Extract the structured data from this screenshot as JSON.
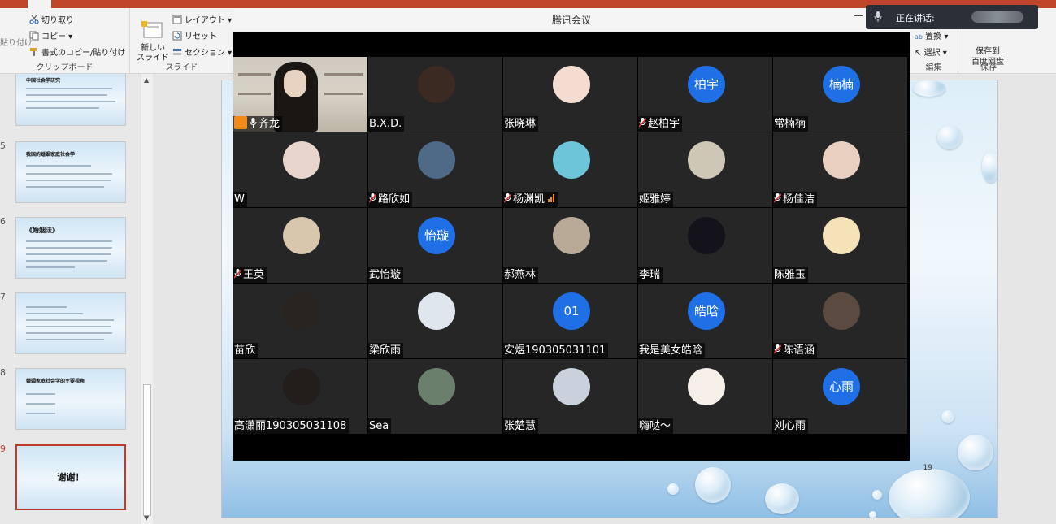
{
  "ribbon": {
    "paste_label": "貼り付け",
    "cut_label": "切り取り",
    "copy_label": "コピー",
    "format_painter_label": "書式のコピー/貼り付け",
    "clipboard_group": "クリップボード",
    "new_slide_label": "新しい\nスライド",
    "layout_label": "レイアウト",
    "reset_label": "リセット",
    "section_label": "セクション",
    "slides_group": "スライド",
    "replace_label": "置換",
    "select_label": "選択",
    "editing_group": "編集",
    "save_to_label": "保存到\n百度网盘",
    "save_group": "保存"
  },
  "slide_panel": {
    "thumbnails": [
      {
        "num": "",
        "title": "中国社会学研究"
      },
      {
        "num": "5",
        "title": "我国的婚姻家庭社会学"
      },
      {
        "num": "6",
        "title": "《婚姻法》"
      },
      {
        "num": "7",
        "title": ""
      },
      {
        "num": "8",
        "title": "婚姻家庭社会学的主要视角"
      },
      {
        "num": "9",
        "title": "谢谢！"
      }
    ]
  },
  "main_slide": {
    "page_number": "19"
  },
  "meeting": {
    "window_title": "腾讯会议",
    "speaking_label": "正在讲话:",
    "participants": [
      {
        "name": "齐龙",
        "muted": false,
        "host": true,
        "avatar_text": "",
        "avatar_color": ""
      },
      {
        "name": "B.X.D.",
        "muted": false,
        "avatar_text": "",
        "avatar_color": "#3a2a22"
      },
      {
        "name": "张晓琳",
        "muted": false,
        "avatar_text": "",
        "avatar_color": "#f3ddd0"
      },
      {
        "name": "赵柏宇",
        "muted": true,
        "avatar_text": "柏宇",
        "avatar_color": "#1f6fe6"
      },
      {
        "name": "常楠楠",
        "muted": false,
        "avatar_text": "楠楠",
        "avatar_color": "#1f6fe6"
      },
      {
        "name": "W",
        "muted": false,
        "avatar_text": "",
        "avatar_color": "#e8d6cc"
      },
      {
        "name": "路欣如",
        "muted": true,
        "avatar_text": "",
        "avatar_color": "#4e6a86"
      },
      {
        "name": "杨渊凯",
        "muted": true,
        "avatar_text": "",
        "avatar_color": "#6cc5d8",
        "signal": true
      },
      {
        "name": "姬雅婷",
        "muted": false,
        "avatar_text": "",
        "avatar_color": "#cfc7b6"
      },
      {
        "name": "杨佳洁",
        "muted": true,
        "avatar_text": "",
        "avatar_color": "#e9cfc0"
      },
      {
        "name": "王英",
        "muted": true,
        "avatar_text": "",
        "avatar_color": "#d8c6ad"
      },
      {
        "name": "武怡璇",
        "muted": false,
        "avatar_text": "怡璇",
        "avatar_color": "#1f6fe6"
      },
      {
        "name": "郝燕林",
        "muted": false,
        "avatar_text": "",
        "avatar_color": "#b9aa98"
      },
      {
        "name": "李瑞",
        "muted": false,
        "avatar_text": "",
        "avatar_color": "#14131c"
      },
      {
        "name": "陈雅玉",
        "muted": false,
        "avatar_text": "",
        "avatar_color": "#f5e2b8"
      },
      {
        "name": "苗欣",
        "muted": false,
        "avatar_text": "",
        "avatar_color": "#2a2420"
      },
      {
        "name": "梁欣雨",
        "muted": false,
        "avatar_text": "",
        "avatar_color": "#dfe6ee"
      },
      {
        "name": "安煜190305031101",
        "muted": false,
        "avatar_text": "01",
        "avatar_color": "#1f6fe6"
      },
      {
        "name": "我是美女皓晗",
        "muted": false,
        "avatar_text": "皓晗",
        "avatar_color": "#1f6fe6"
      },
      {
        "name": "陈语涵",
        "muted": true,
        "avatar_text": "",
        "avatar_color": "#5a4a40"
      },
      {
        "name": "高潇丽190305031108",
        "muted": false,
        "avatar_text": "",
        "avatar_color": "#231d1b"
      },
      {
        "name": "Sea",
        "muted": false,
        "avatar_text": "",
        "avatar_color": "#6a7f6c"
      },
      {
        "name": "张楚慧",
        "muted": false,
        "avatar_text": "",
        "avatar_color": "#c9d1dc"
      },
      {
        "name": "嗨哒～",
        "muted": false,
        "avatar_text": "",
        "avatar_color": "#f6efe8"
      },
      {
        "name": "刘心雨",
        "muted": false,
        "avatar_text": "心雨",
        "avatar_color": "#1f6fe6"
      }
    ]
  }
}
